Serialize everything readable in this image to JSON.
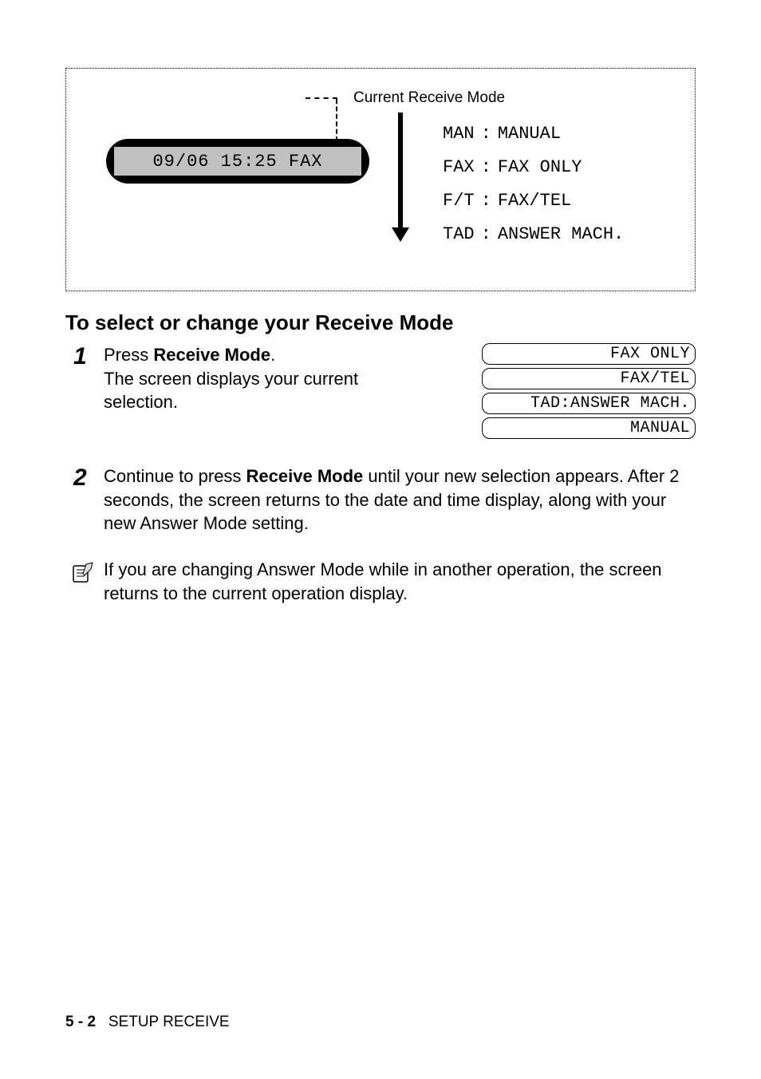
{
  "diagram": {
    "caption": "Current Receive Mode",
    "lcd": "09/06 15:25  FAX",
    "modes": [
      {
        "code": "MAN",
        "label": "MANUAL"
      },
      {
        "code": "FAX",
        "label": "FAX ONLY"
      },
      {
        "code": "F/T",
        "label": "FAX/TEL"
      },
      {
        "code": "TAD",
        "label": "ANSWER MACH."
      }
    ]
  },
  "heading": "To select or change your Receive Mode",
  "steps": {
    "s1": {
      "num": "1",
      "line1_pre": "Press ",
      "line1_bold": "Receive Mode",
      "line1_post": ".",
      "line2": "The screen displays your current selection."
    },
    "s2": {
      "num": "2",
      "pre": "Continue to press ",
      "bold": "Receive Mode",
      "post": " until your new selection appears. After 2 seconds, the screen returns to the date and time display, along with your new Answer Mode setting."
    }
  },
  "lcd_options": [
    "FAX ONLY",
    "FAX/TEL",
    "TAD:ANSWER MACH.",
    "MANUAL"
  ],
  "note": "If you are changing Answer Mode while in another operation, the screen returns to the current operation display.",
  "footer": {
    "page": "5 - 2",
    "section": "SETUP RECEIVE"
  }
}
